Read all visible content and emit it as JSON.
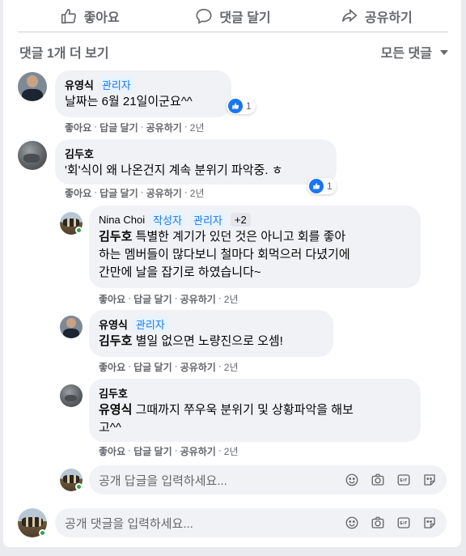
{
  "actions": {
    "like": "좋아요",
    "comment": "댓글 달기",
    "share": "공유하기"
  },
  "more_comments": "댓글 1개 더 보기",
  "filter": "모든 댓글",
  "meta": {
    "like": "좋아요",
    "reply": "답글 달기",
    "share": "공유하기",
    "sep": "·"
  },
  "comments": [
    {
      "author": "유영식",
      "badge": "관리자",
      "text": "날짜는 6월 21일이군요^^",
      "time": "2년",
      "reactions": "1"
    },
    {
      "author": "김두호",
      "text": "'회'식이 왜 나온건지 계속 분위기 파악중. ㅎ",
      "time": "2년",
      "reactions": "1"
    }
  ],
  "replies": [
    {
      "author": "Nina Choi",
      "badge1": "작성자",
      "badge2": "관리자",
      "more": "+2",
      "mention": "김두호",
      "text_line1": " 특별한 계기가 있던 것은 아니고 회를 좋아",
      "text_line2": "하는 멤버들이 많다보니 철마다 회먹으러 다녔기에",
      "text_line3": "간만에 날을 잡기로 하였습니다~",
      "time": "2년"
    },
    {
      "author": "유영식",
      "badge": "관리자",
      "mention": "김두호",
      "text": " 별일 없으면 노량진으로 오셈!",
      "time": "2년"
    },
    {
      "author": "김두호",
      "mention": "유영식",
      "text_line1": " 그때까지 쭈우욱 분위기 및 상황파악을 해보",
      "text_line2": "고^^",
      "time": "2년"
    }
  ],
  "reply_input": {
    "placeholder": "공개 답글을 입력하세요..."
  },
  "comment_input": {
    "placeholder": "공개 댓글을 입력하세요..."
  }
}
